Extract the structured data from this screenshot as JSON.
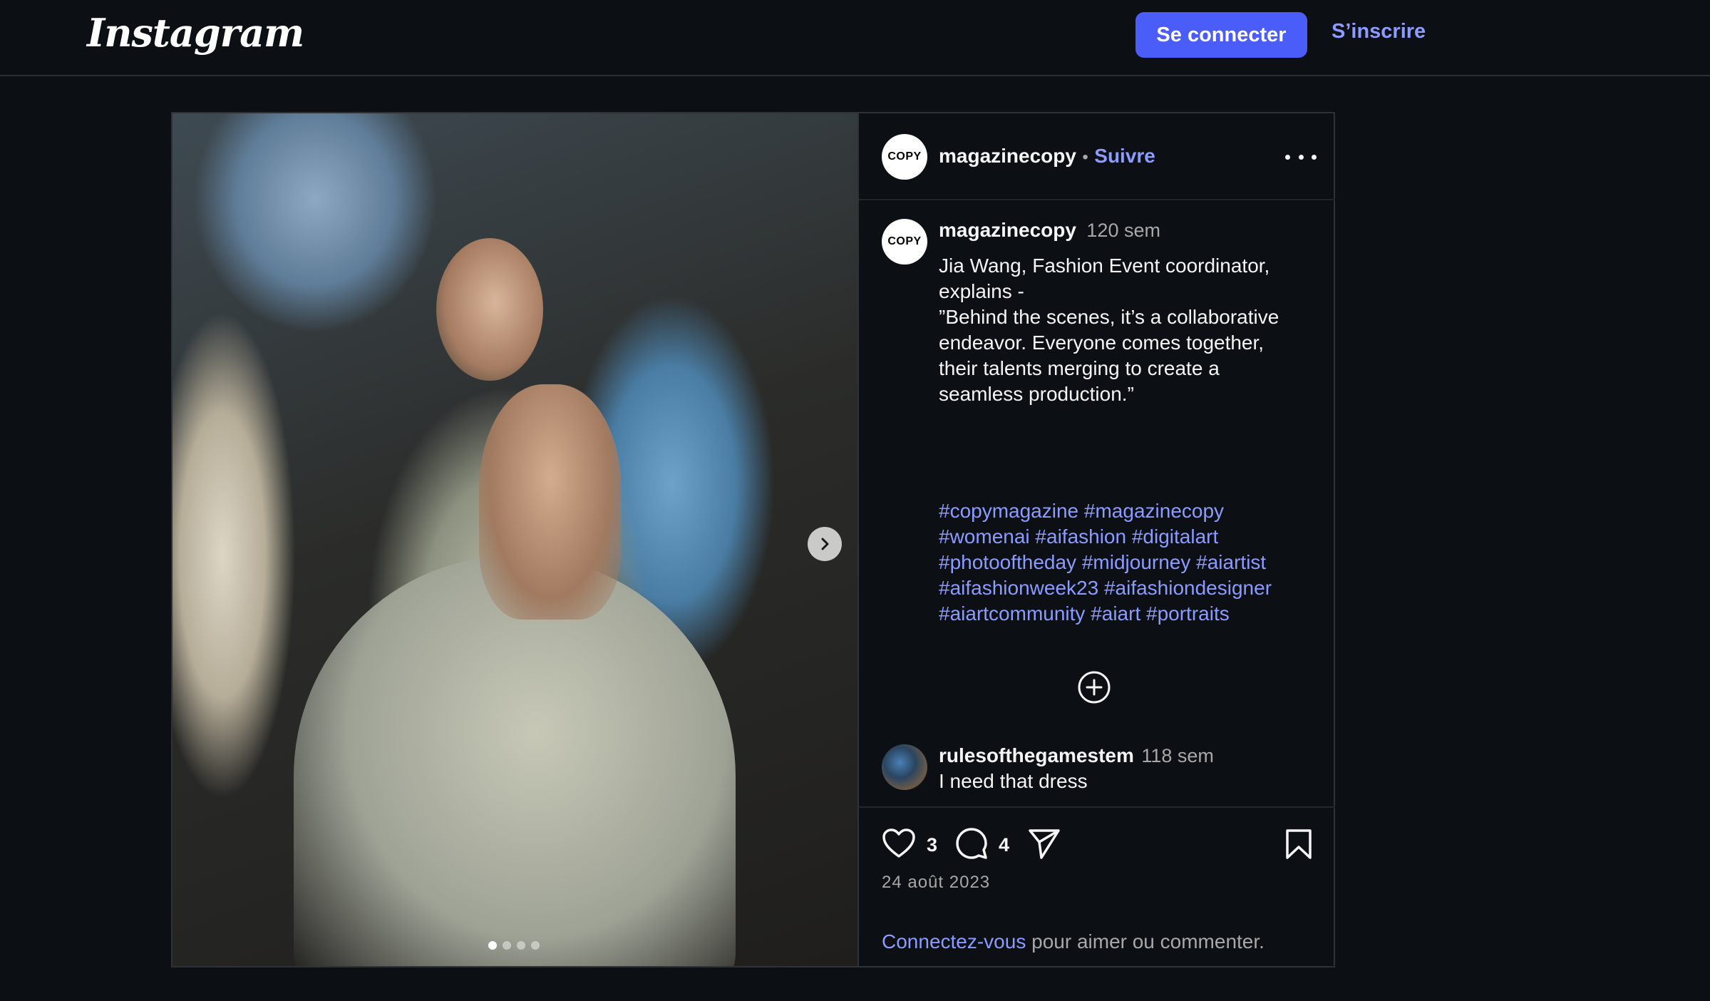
{
  "header": {
    "logo_text": "Instagram",
    "login_label": "Se connecter",
    "signup_label": "S’inscrire"
  },
  "post": {
    "carousel": {
      "slide_count": 4,
      "active_slide": 1
    },
    "author": {
      "username": "magazinecopy",
      "avatar_text": "COPY",
      "separator": "•",
      "follow_label": "Suivre"
    },
    "caption": {
      "username": "magazinecopy",
      "age": "120 sem",
      "lines": [
        "Jia Wang, Fashion Event coordinator,",
        "explains -",
        "”Behind the scenes, it’s a collaborative",
        "endeavor. Everyone comes together,",
        "their talents merging to create a",
        "seamless production.”"
      ],
      "hashtags": [
        "#copymagazine",
        "#magazinecopy",
        "#womenai",
        "#aifashion",
        "#digitalart",
        "#photooftheday",
        "#midjourney",
        "#aiartist",
        "#aifashionweek23",
        "#aifashiondesigner",
        "#aiartcommunity",
        "#aiart",
        "#portraits"
      ]
    },
    "comment": {
      "username": "rulesofthegamestem",
      "age": "118 sem",
      "text": "I need that dress"
    },
    "likes_count": "3",
    "comments_count": "4",
    "date": "24 août 2023",
    "login_prompt": {
      "link": "Connectez-vous",
      "rest": "pour aimer ou commenter."
    }
  },
  "colors": {
    "background": "#0c1014",
    "accent_button": "#4a5df9",
    "link": "#8c9bff",
    "text": "#f5f5f5",
    "muted": "#a8a8a8"
  },
  "icons": [
    "heart-icon",
    "comment-icon",
    "share-icon",
    "bookmark-icon",
    "more-options-icon",
    "plus-circle-icon",
    "chevron-right-icon"
  ]
}
